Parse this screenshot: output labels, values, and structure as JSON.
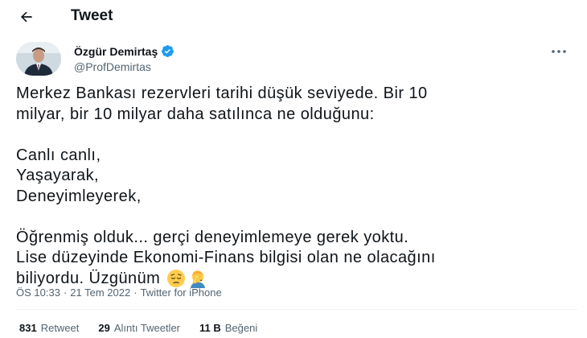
{
  "header": {
    "title": "Tweet"
  },
  "author": {
    "display_name": "Özgür Demirtaş",
    "handle": "@ProfDemirtas"
  },
  "tweet": {
    "paragraphs": [
      [
        "Merkez Bankası rezervleri tarihi düşük seviyede. Bir 10",
        "milyar, bir 10 milyar daha satılınca ne olduğunu:"
      ],
      [
        "Canlı canlı,",
        "Yaşayarak,",
        "Deneyimleyerek,"
      ],
      [
        "Öğrenmiş olduk... gerçi deneyimlemeye gerek yoktu.",
        "Lise düzeyinde Ekonomi-Finans bilgisi olan ne olacağını",
        "biliyordu. Üzgünüm"
      ]
    ],
    "emojis": [
      "pensive-face-emoji",
      "person-facepalming-emoji"
    ]
  },
  "meta": {
    "time": "ÖS 10:33",
    "separator1": "·",
    "date": "21 Tem 2022",
    "separator2": "·",
    "source": "Twitter for iPhone"
  },
  "stats": {
    "retweets": {
      "count": "831",
      "label": "Retweet"
    },
    "quotes": {
      "count": "29",
      "label": "Alıntı Tweetler"
    },
    "likes": {
      "count": "11 B",
      "label": "Beğeni"
    }
  },
  "colors": {
    "text": "#0f1419",
    "secondary": "#536471",
    "verified": "#1d9bf0",
    "divider": "#eff3f4"
  }
}
